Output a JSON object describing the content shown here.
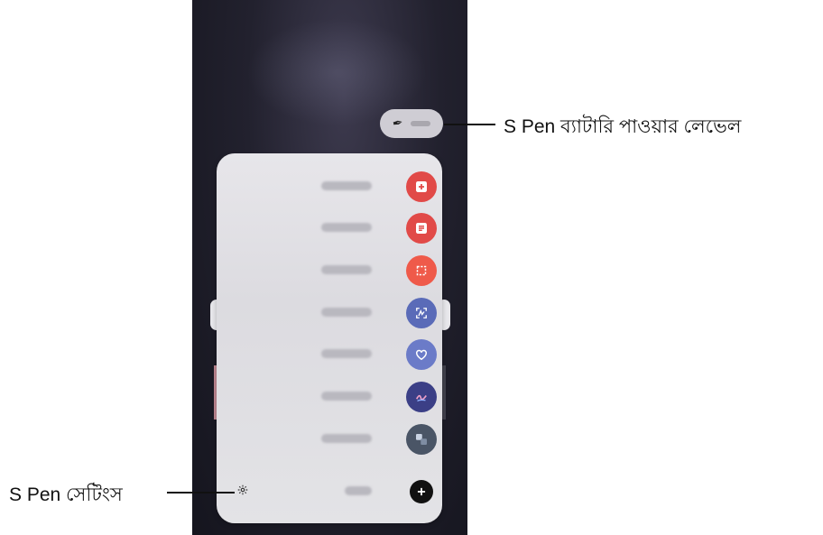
{
  "callouts": {
    "battery": "S Pen ব্যাটারি পাওয়ার লেভেল",
    "settings": "S Pen সেটিংস"
  },
  "panel": {
    "items": [
      {
        "icon": "create-note-icon",
        "color": "#e14a48"
      },
      {
        "icon": "view-all-notes-icon",
        "color": "#e14a48"
      },
      {
        "icon": "smart-select-icon",
        "color": "#ef5a4a"
      },
      {
        "icon": "screen-write-icon",
        "color": "#5a6bb8"
      },
      {
        "icon": "live-messages-icon",
        "color": "#6b7bc8"
      },
      {
        "icon": "ar-doodle-icon",
        "color": "#3b3f86"
      },
      {
        "icon": "translate-icon",
        "color": "#4a5566"
      },
      {
        "icon": "add-icon",
        "color": "#111111"
      }
    ]
  }
}
